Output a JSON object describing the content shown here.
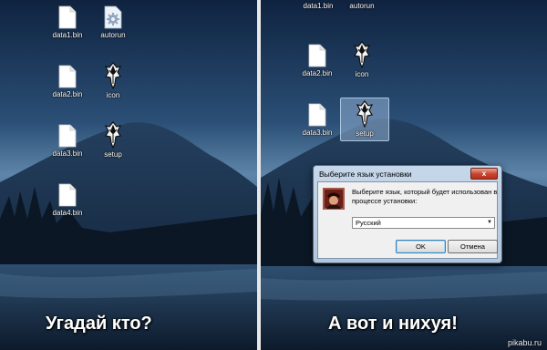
{
  "left_panel": {
    "icons": [
      {
        "label": "data1.bin",
        "icon": "file-icon"
      },
      {
        "label": "autorun",
        "icon": "settings-file-icon"
      },
      {
        "label": "data2.bin",
        "icon": "file-icon"
      },
      {
        "label": "icon",
        "icon": "skyrim-logo-icon"
      },
      {
        "label": "data3.bin",
        "icon": "file-icon"
      },
      {
        "label": "setup",
        "icon": "skyrim-logo-icon"
      },
      {
        "label": "data4.bin",
        "icon": "file-icon"
      }
    ],
    "caption": "Угадай кто?"
  },
  "right_panel": {
    "icons": [
      {
        "label": "data1.bin",
        "icon": "file-icon"
      },
      {
        "label": "autorun",
        "icon": "settings-file-icon"
      },
      {
        "label": "data2.bin",
        "icon": "file-icon"
      },
      {
        "label": "icon",
        "icon": "skyrim-logo-icon"
      },
      {
        "label": "data3.bin",
        "icon": "file-icon"
      },
      {
        "label": "setup",
        "icon": "skyrim-logo-icon",
        "selected": true
      }
    ],
    "caption": "А вот и нихуя!"
  },
  "dialog": {
    "title": "Выберите язык установки",
    "message": "Выберите язык, который будет использован в процессе установки:",
    "selected_language": "Русский",
    "ok_label": "OK",
    "cancel_label": "Отмена",
    "close_glyph": "x"
  },
  "watermark": "pikabu.ru"
}
